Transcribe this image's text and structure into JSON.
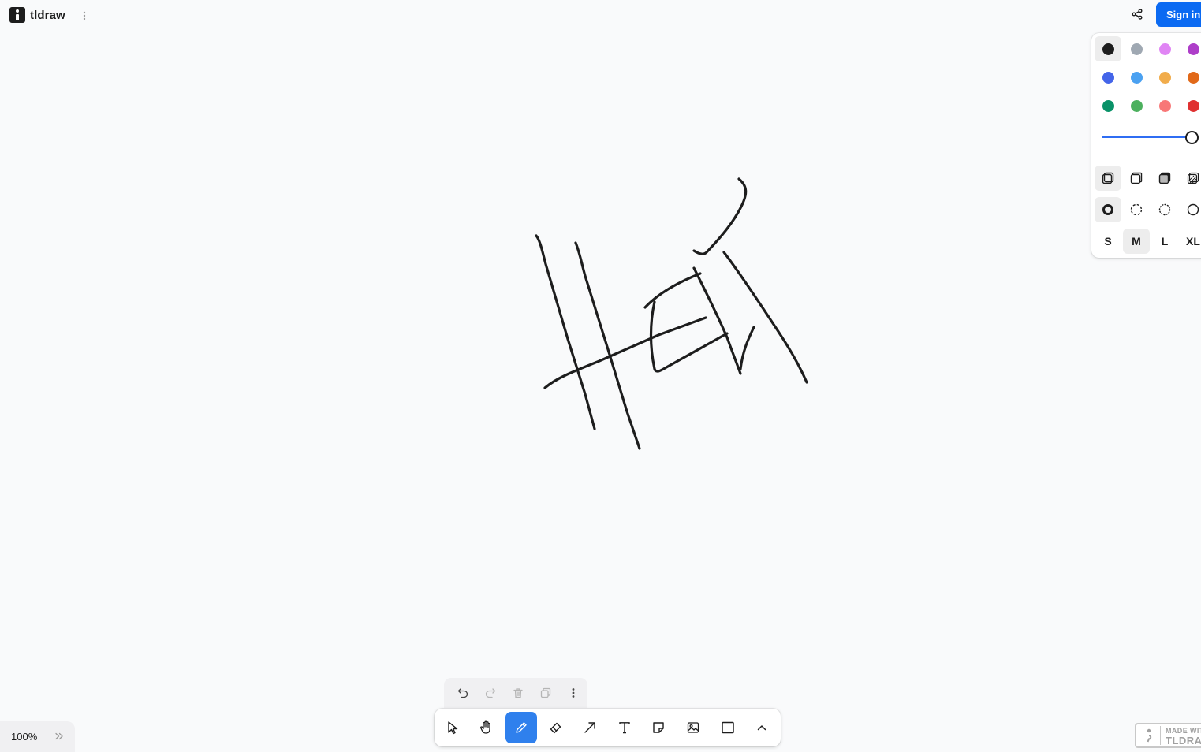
{
  "app": {
    "title": "tldraw"
  },
  "header": {
    "sign_in_label": "Sign in"
  },
  "style_panel": {
    "colors": [
      {
        "name": "black",
        "hex": "#1d1d1d",
        "selected": true
      },
      {
        "name": "grey",
        "hex": "#9fa8b2"
      },
      {
        "name": "light-violet",
        "hex": "#e085f4"
      },
      {
        "name": "violet",
        "hex": "#ae3ec9"
      },
      {
        "name": "blue",
        "hex": "#4465e9"
      },
      {
        "name": "light-blue",
        "hex": "#4ba1f1"
      },
      {
        "name": "yellow",
        "hex": "#f1ac4b"
      },
      {
        "name": "orange",
        "hex": "#e16919"
      },
      {
        "name": "green",
        "hex": "#099268"
      },
      {
        "name": "light-green",
        "hex": "#4cb05e"
      },
      {
        "name": "light-red",
        "hex": "#f87777"
      },
      {
        "name": "red",
        "hex": "#e03131"
      }
    ],
    "opacity": 1.0,
    "fills": [
      "fill-none-icon",
      "fill-semi-icon",
      "fill-solid-icon",
      "fill-pattern-icon"
    ],
    "dashes": [
      "dash-draw-icon",
      "dash-dashed-icon",
      "dash-dotted-icon",
      "dash-solid-icon"
    ],
    "sizes": [
      "S",
      "M",
      "L",
      "XL"
    ],
    "selected_size": "M"
  },
  "actions": [
    "undo-icon",
    "redo-icon",
    "trash-icon",
    "duplicate-icon",
    "more-vertical-icon"
  ],
  "tools": [
    "select",
    "hand",
    "draw",
    "eraser",
    "arrow",
    "text",
    "note",
    "asset",
    "rectangle",
    "more"
  ],
  "active_tool": "draw",
  "zoom": {
    "label": "100%"
  },
  "watermark": {
    "line1": "MADE WITH",
    "line2": "TLDRAW"
  },
  "colors": {
    "accent": "#2f80ed",
    "sign_in": "#0b6af2",
    "ink": "#1d1d1d",
    "canvas": "#f9fafb"
  }
}
